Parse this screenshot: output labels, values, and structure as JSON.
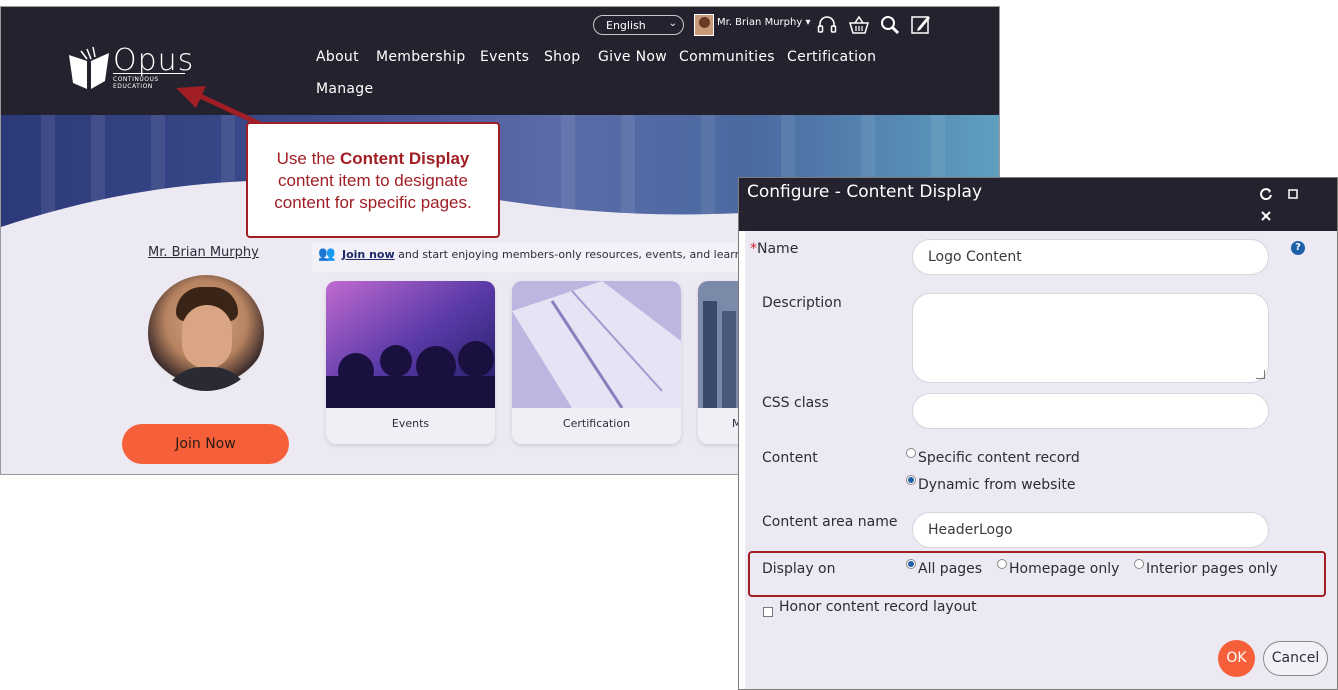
{
  "site": {
    "language": "English",
    "user_name": "Mr. Brian Murphy",
    "logo_title": "Opus",
    "logo_subtitle": "CONTINUOUS EDUCATION",
    "nav": [
      "About",
      "Membership",
      "Events",
      "Shop",
      "Give Now",
      "Communities",
      "Certification",
      "Manage"
    ],
    "profile_name": "Mr. Brian Murphy",
    "join_button": "Join Now",
    "promo_link": "Join now",
    "promo_text": " and start enjoying members-only resources, events, and learni",
    "cards": [
      "Events",
      "Certification",
      "M"
    ]
  },
  "callout": {
    "line1_pre": "Use the ",
    "line1_bold": "Content Display",
    "line2": "content item to designate",
    "line3": "content for specific pages."
  },
  "dialog": {
    "title": "Configure - Content Display",
    "name_required": "*",
    "name_label": "Name",
    "name_value": "Logo Content",
    "description_label": "Description",
    "css_label": "CSS class",
    "content_label": "Content",
    "content_options": [
      "Specific content record",
      "Dynamic from website"
    ],
    "content_selected": "Dynamic from website",
    "area_label": "Content area name",
    "area_value": "HeaderLogo",
    "display_label": "Display on",
    "display_options": [
      "All pages",
      "Homepage only",
      "Interior pages only"
    ],
    "display_selected": "All pages",
    "honor_label": "Honor content record layout",
    "ok": "OK",
    "cancel": "Cancel",
    "help": "?"
  },
  "colors": {
    "header": "#23222e",
    "accent": "#f5603a",
    "callout": "#a01e24",
    "link_blue": "#1f5fa8"
  }
}
